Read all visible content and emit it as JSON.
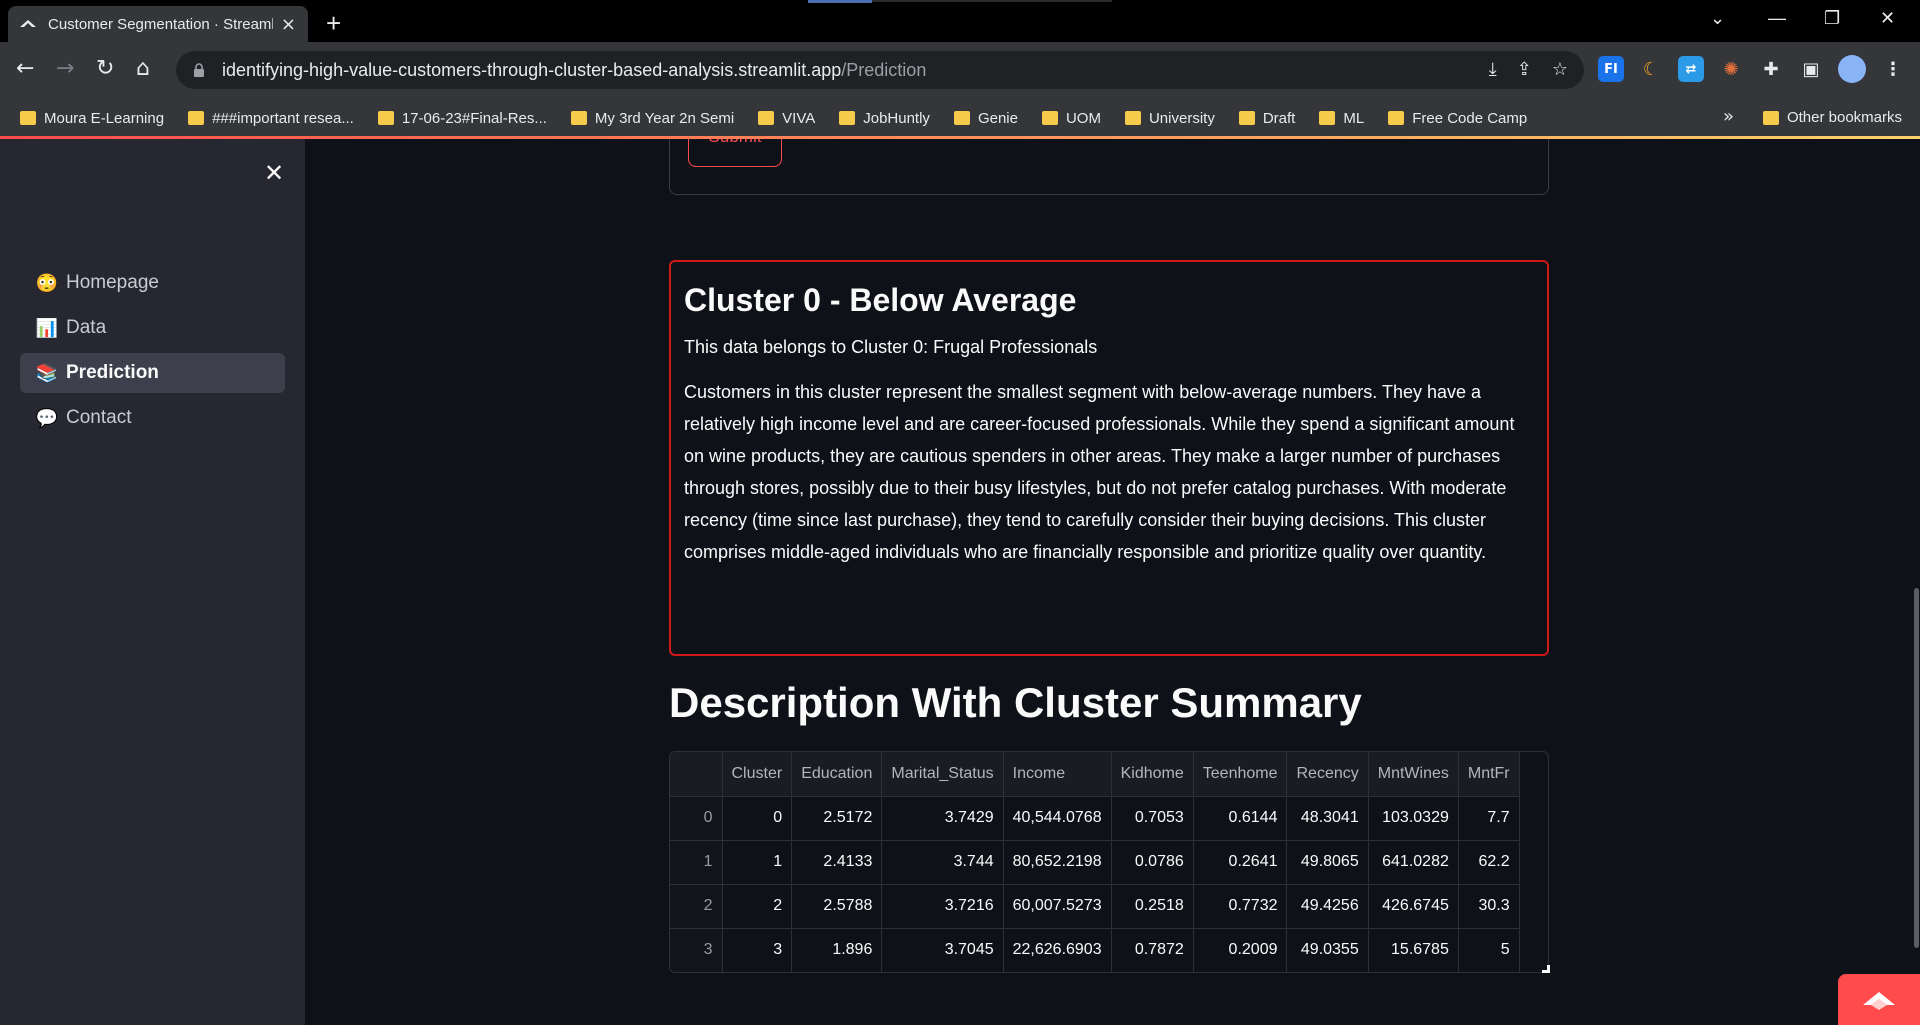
{
  "browser": {
    "tab_title": "Customer Segmentation · Streamlit",
    "new_tab": "+",
    "url_host": "identifying-high-value-customers-through-cluster-based-analysis.streamlit.app",
    "url_path": "/Prediction",
    "bookmarks": [
      "Moura E-Learning",
      "###important resea...",
      "17-06-23#Final-Res...",
      "My 3rd Year 2n Semi",
      "VIVA",
      "JobHuntly",
      "Genie",
      "UOM",
      "University",
      "Draft",
      "ML",
      "Free Code Camp"
    ],
    "bookmarks_more": "»",
    "other_bookmarks": "Other bookmarks",
    "extensions": [
      "FI"
    ]
  },
  "sidebar": {
    "close": "✕",
    "items": [
      {
        "label": "Homepage",
        "icon": "😳"
      },
      {
        "label": "Data",
        "icon": "📊"
      },
      {
        "label": "Prediction",
        "icon": "📚"
      },
      {
        "label": "Contact",
        "icon": "💬"
      }
    ],
    "active": "Prediction"
  },
  "form": {
    "submit_label": "Submit"
  },
  "cluster": {
    "title": "Cluster 0 - Below Average",
    "subtitle": "This data belongs to Cluster 0: Frugal Professionals",
    "description": "Customers in this cluster represent the smallest segment with below-average numbers. They have a relatively high income level and are career-focused professionals. While they spend a significant amount on wine products, they are cautious spenders in other areas. They make a larger number of purchases through stores, possibly due to their busy lifestyles, but do not prefer catalog purchases. With moderate recency (time since last purchase), they tend to carefully consider their buying decisions. This cluster comprises middle-aged individuals who are financially responsible and prioritize quality over quantity.",
    "border_color": "#d01919"
  },
  "summary": {
    "title": "Description With Cluster Summary",
    "columns": [
      "",
      "Cluster",
      "Education",
      "Marital_Status",
      "Income",
      "Kidhome",
      "Teenhome",
      "Recency",
      "MntWines",
      "MntFr"
    ],
    "rows": [
      [
        "0",
        "0",
        "2.5172",
        "3.7429",
        "40,544.0768",
        "0.7053",
        "0.6144",
        "48.3041",
        "103.0329",
        "7.7"
      ],
      [
        "1",
        "1",
        "2.4133",
        "3.744",
        "80,652.2198",
        "0.0786",
        "0.2641",
        "49.8065",
        "641.0282",
        "62.2"
      ],
      [
        "2",
        "2",
        "2.5788",
        "3.7216",
        "60,007.5273",
        "0.2518",
        "0.7732",
        "49.4256",
        "426.6745",
        "30.3"
      ],
      [
        "3",
        "3",
        "1.896",
        "3.7045",
        "22,626.6903",
        "0.7872",
        "0.2009",
        "49.0355",
        "15.6785",
        "5"
      ]
    ]
  },
  "colors": {
    "accent": "#ff4b4b",
    "sidebar_bg": "#262730",
    "main_bg": "#0e1117"
  }
}
